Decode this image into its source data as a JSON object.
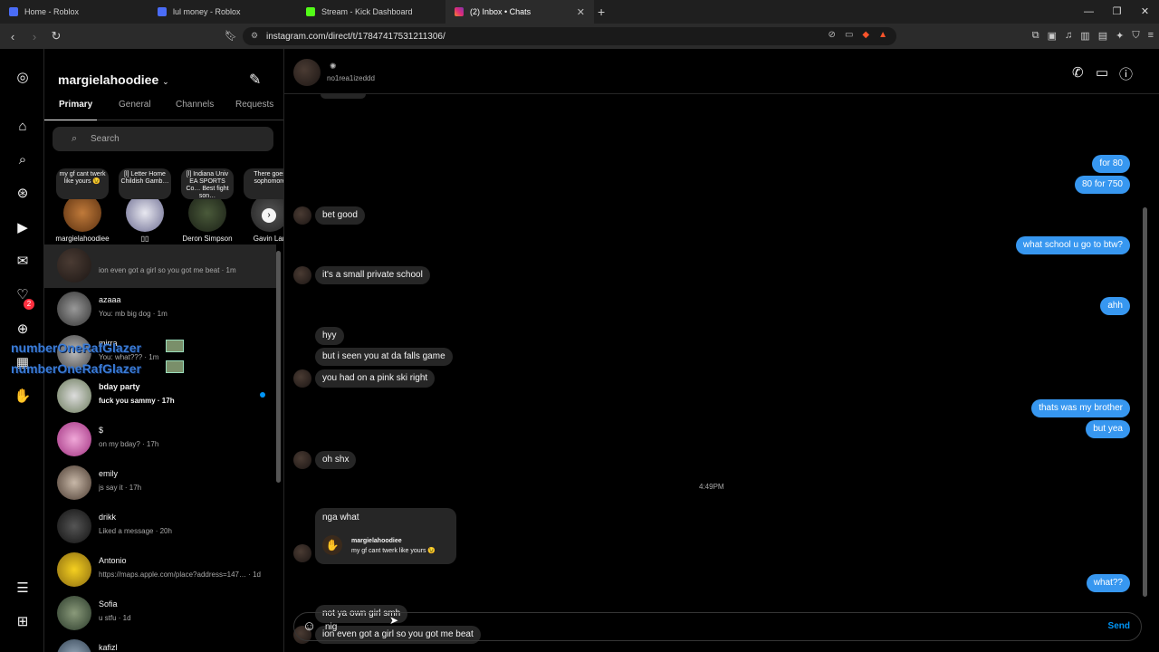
{
  "browser": {
    "tabs": [
      {
        "title": "Home - Roblox",
        "color": "#4a6cf7"
      },
      {
        "title": "lul money - Roblox",
        "color": "#4a6cf7"
      },
      {
        "title": "Stream - Kick Dashboard",
        "color": "#53fc18"
      },
      {
        "title": "(2) Inbox • Chats",
        "color": "#e1306c"
      }
    ],
    "url": "instagram.com/direct/t/17847417531211306/"
  },
  "inbox": {
    "username": "margielahoodiee",
    "tabs": [
      "Primary",
      "General",
      "Channels",
      "Requests"
    ],
    "search_placeholder": "Search",
    "notes": [
      {
        "text": "my gf cant twerk like yours 😉",
        "name": "margielahoodiee"
      },
      {
        "text": "[l] Letter Home Childish Gamb…",
        "name": "▯▯"
      },
      {
        "text": "[l] Indiana Univ EA SPORTS Co… Best fight son…",
        "name": "Deron Simpson"
      },
      {
        "text": "There goes sophomore",
        "name": "Gavin Larl"
      }
    ],
    "conversations": [
      {
        "name": "",
        "preview": "ion even got a girl so you got me beat · 1m",
        "unread": false,
        "bold": false
      },
      {
        "name": "azaaa",
        "preview": "You: mb big dog · 1m",
        "unread": false,
        "bold": false
      },
      {
        "name": "mirra",
        "preview": "You: what??? · 1m",
        "unread": false,
        "bold": false
      },
      {
        "name": "bday party",
        "preview": "fuck you sammy · 17h",
        "unread": true,
        "bold": true
      },
      {
        "name": "$",
        "preview": "on my bday? · 17h",
        "unread": false,
        "bold": false
      },
      {
        "name": "emily",
        "preview": "js say it · 17h",
        "unread": false,
        "bold": false
      },
      {
        "name": "drikk",
        "preview": "Liked a message · 20h",
        "unread": false,
        "bold": false
      },
      {
        "name": "Antonio",
        "preview": "https://maps.apple.com/place?address=147… · 1d",
        "unread": false,
        "bold": false
      },
      {
        "name": "Sofia",
        "preview": "u stfu · 1d",
        "unread": false,
        "bold": false
      },
      {
        "name": "kafizl",
        "preview": "",
        "unread": false,
        "bold": false
      }
    ],
    "overlay_text": "numberOneRafGlazer"
  },
  "rail": {
    "notification_count": "2"
  },
  "chat": {
    "header_name": "no1rea1izeddd",
    "messages": [
      {
        "text": "for 80",
        "side": "out"
      },
      {
        "text": "80 for 750",
        "side": "out"
      },
      {
        "text": "bet good",
        "side": "in"
      },
      {
        "text": "what school u go to btw?",
        "side": "out"
      },
      {
        "text": "it's a small private school",
        "side": "in"
      },
      {
        "text": "ahh",
        "side": "out"
      },
      {
        "text": "hyy",
        "side": "in"
      },
      {
        "text": "but i seen you at da falls game",
        "side": "in"
      },
      {
        "text": "you had on a pink ski right",
        "side": "in"
      },
      {
        "text": "thats was my brother",
        "side": "out"
      },
      {
        "text": "but yea",
        "side": "out"
      },
      {
        "text": "oh shx",
        "side": "in"
      },
      {
        "text": "what??",
        "side": "out"
      },
      {
        "text": "not ya own girl smh",
        "side": "in"
      },
      {
        "text": "ion even got a girl so you got me beat",
        "side": "in"
      }
    ],
    "timestamp": "4:49PM",
    "reply": {
      "text": "nga what",
      "quoted_user": "margielahoodiee",
      "quoted_note": "my gf cant twerk like yours 😉"
    },
    "composer": {
      "text": "nig",
      "send_label": "Send"
    }
  }
}
